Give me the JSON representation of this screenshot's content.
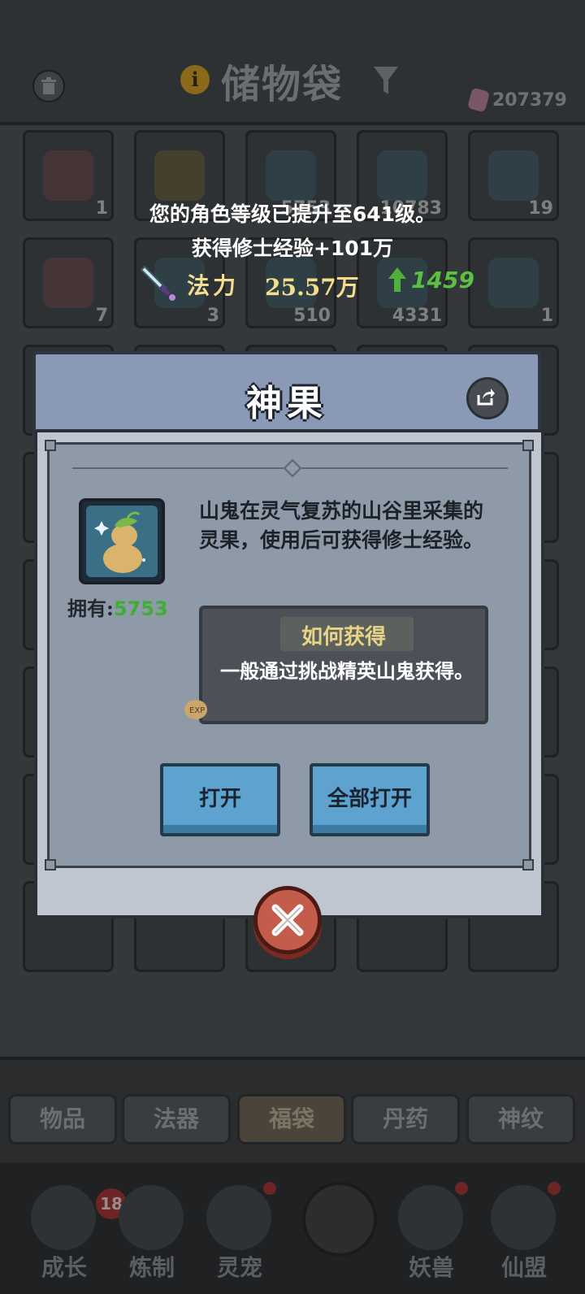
{
  "header": {
    "title": "储物袋",
    "info_icon": "info-icon",
    "currency": "207379"
  },
  "inventory": {
    "cells": [
      {
        "count": "1",
        "icon": "red-book-icon",
        "color": "#5a3838"
      },
      {
        "count": "",
        "icon": "gold-pouch-icon",
        "color": "#5a4a2a"
      },
      {
        "count": "5753",
        "icon": "gourd-icon",
        "color": "#2f4a56"
      },
      {
        "count": "10783",
        "icon": "vase-icon",
        "color": "#2f4a56"
      },
      {
        "count": "19",
        "icon": "treasure-pouch-icon",
        "color": "#2f4a56"
      },
      {
        "count": "7",
        "icon": "blue-book-icon",
        "color": "#5a3838"
      },
      {
        "count": "3",
        "icon": "cauldron-icon",
        "color": "#2f4a56"
      },
      {
        "count": "510",
        "icon": "bag-icon",
        "color": "#2f4a56"
      },
      {
        "count": "4331",
        "icon": "chest-icon",
        "color": "#2f4a56"
      },
      {
        "count": "1",
        "icon": "jar-icon",
        "color": "#2f4a56"
      }
    ]
  },
  "notices": {
    "level_up": "您的角色等级已提升至641级。",
    "exp_gain": "获得修士经验+101万",
    "power_label": "法力",
    "power_value": "25.57万",
    "power_increase": "1459"
  },
  "modal": {
    "title": "神果",
    "owned_label": "拥有:",
    "owned_count": "5753",
    "description": "山鬼在灵气复苏的山谷里采集的灵果，使用后可获得修士经验。",
    "how_title": "如何获得",
    "how_text": "一般通过挑战精英山鬼获得。",
    "open_button": "打开",
    "open_all_button": "全部打开"
  },
  "tabs": [
    "物品",
    "法器",
    "福袋",
    "丹药",
    "神纹"
  ],
  "active_tab": "福袋",
  "bottom_nav": {
    "items": [
      "成长",
      "炼制",
      "灵宠",
      "妖兽",
      "仙盟"
    ],
    "growth_badge": "18"
  }
}
